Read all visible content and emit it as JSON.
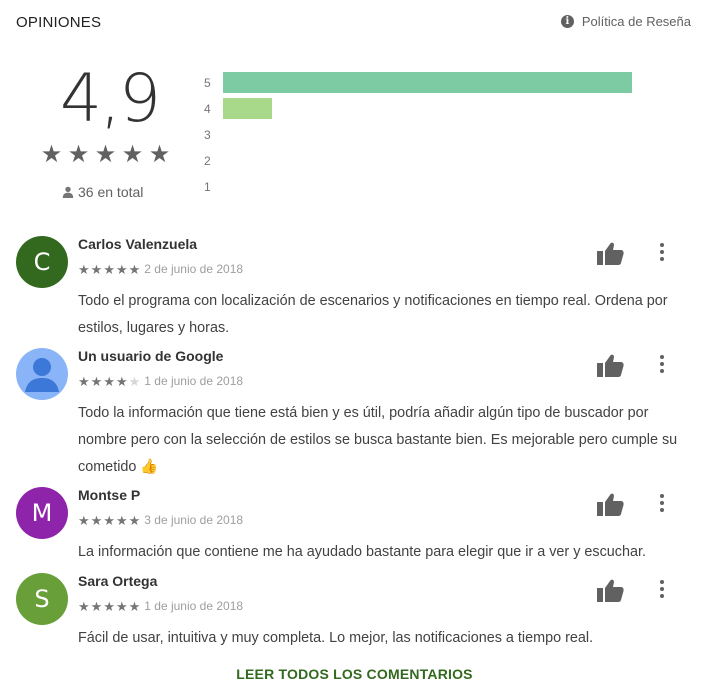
{
  "header": {
    "title": "OPINIONES",
    "policy_label": "Política de Reseña"
  },
  "summary": {
    "score": "4,9",
    "stars_filled": 5,
    "total_label": "36 en total"
  },
  "histogram": [
    {
      "label": "5",
      "fraction": 1.0,
      "color": "#7ccba2"
    },
    {
      "label": "4",
      "fraction": 0.12,
      "color": "#a8d88a"
    },
    {
      "label": "3",
      "fraction": 0,
      "color": "#f7d36b"
    },
    {
      "label": "2",
      "fraction": 0,
      "color": "#f5a65b"
    },
    {
      "label": "1",
      "fraction": 0,
      "color": "#f4806d"
    }
  ],
  "reviews": [
    {
      "author": "Carlos Valenzuela",
      "avatar_letter": "C",
      "avatar_color": "#33691e",
      "rating": 5,
      "date": "2 de junio de 2018",
      "text": "Todo el programa con localización de escenarios y notificaciones en tiempo real. Ordena por estilos, lugares y horas."
    },
    {
      "author": "Un usuario de Google",
      "avatar_letter": "",
      "avatar_color": "#8ab4f8",
      "rating": 4,
      "date": "1 de junio de 2018",
      "text": "Todo la información que tiene está bien y es útil, podría añadir algún tipo de buscador por nombre pero con la selección de estilos se busca bastante bien. Es mejorable pero cumple su cometido 👍"
    },
    {
      "author": "Montse P",
      "avatar_letter": "M",
      "avatar_color": "#8e24aa",
      "rating": 5,
      "date": "3 de junio de 2018",
      "text": "La información que contiene me ha ayudado bastante para elegir que ir a ver y escuchar."
    },
    {
      "author": "Sara Ortega",
      "avatar_letter": "S",
      "avatar_color": "#689f38",
      "rating": 5,
      "date": "1 de junio de 2018",
      "text": "Fácil de usar, intuitiva y muy completa. Lo mejor, las notificaciones a tiempo real."
    }
  ],
  "footer": {
    "read_all_label": "LEER TODOS LOS COMENTARIOS"
  }
}
